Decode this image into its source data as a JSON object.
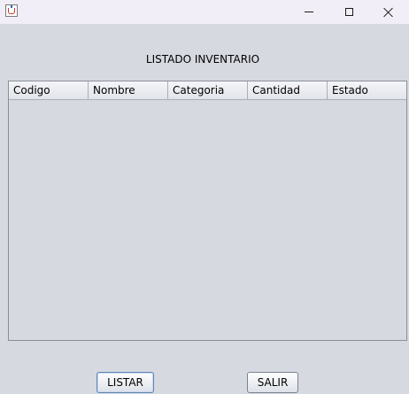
{
  "window": {
    "icon": "java-cup-icon",
    "controls": [
      "minimize-icon",
      "maximize-icon",
      "close-icon"
    ]
  },
  "heading": "LISTADO INVENTARIO",
  "table": {
    "columns": [
      "Codigo",
      "Nombre",
      "Categoria",
      "Cantidad",
      "Estado"
    ],
    "rows": []
  },
  "buttons": {
    "listar": "LISTAR",
    "salir": "SALIR"
  }
}
